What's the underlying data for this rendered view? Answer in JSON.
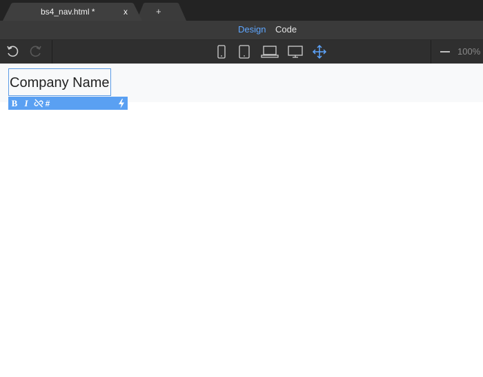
{
  "tabs": {
    "active_title": "bs4_nav.html *",
    "close_label": "x",
    "new_tab_label": "+"
  },
  "modes": {
    "design_label": "Design",
    "code_label": "Code",
    "active": "Design"
  },
  "toolbar": {
    "zoom_label": "100%",
    "icons": [
      "undo-icon",
      "redo-icon",
      "mobile-icon",
      "tablet-icon",
      "laptop-icon",
      "desktop-icon",
      "move-icon",
      "zoom-out-icon"
    ]
  },
  "canvas": {
    "brand_text": "Company Name"
  },
  "text_toolbar": {
    "bold_label": "B",
    "italic_label": "I",
    "hash_label": "#"
  },
  "colors": {
    "accent": "#5aa0f2",
    "mode_active": "#5ea6ff",
    "navbar_bg": "#f8f9fa",
    "chrome_dark": "#2f2f2f"
  }
}
